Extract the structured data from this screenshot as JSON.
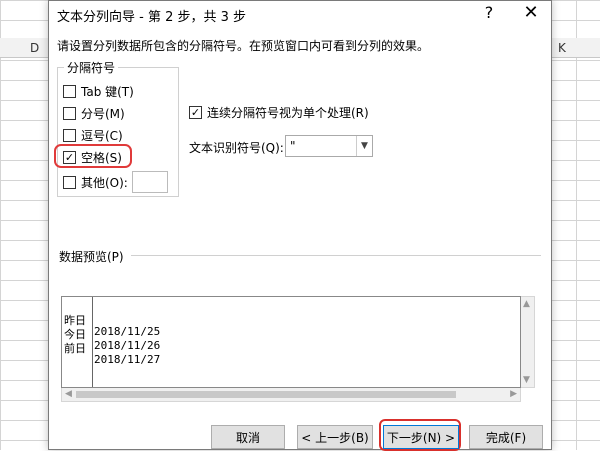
{
  "background": {
    "column_letters": [
      "D",
      "K"
    ]
  },
  "dialog": {
    "title": "文本分列向导 - 第 2 步，共 3 步",
    "help_icon": "?",
    "close_icon": "✕",
    "instruction": "请设置分列数据所包含的分隔符号。在预览窗口内可看到分列的效果。",
    "delimiters": {
      "legend": "分隔符号",
      "tab_label": "Tab 键(T)",
      "tab_checked": false,
      "semicolon_label": "分号(M)",
      "semicolon_checked": false,
      "comma_label": "逗号(C)",
      "comma_checked": false,
      "space_label": "空格(S)",
      "space_checked": true,
      "other_label": "其他(O):",
      "other_checked": false,
      "other_value": ""
    },
    "consecutive_label": "连续分隔符号视为单个处理(R)",
    "consecutive_checked": true,
    "qualifier_label": "文本识别符号(Q):",
    "qualifier_value": "\"",
    "preview_label": "数据预览(P)",
    "preview_rows": [
      {
        "col1": "昨日",
        "col2": "2018/11/25"
      },
      {
        "col1": "今日",
        "col2": "2018/11/26"
      },
      {
        "col1": "前日",
        "col2": "2018/11/27"
      }
    ],
    "buttons": {
      "cancel": "取消",
      "back": "< 上一步(B)",
      "next": "下一步(N) >",
      "finish": "完成(F)"
    }
  },
  "colors": {
    "highlight": "#e03a3a",
    "primary_border": "#0078d7"
  }
}
